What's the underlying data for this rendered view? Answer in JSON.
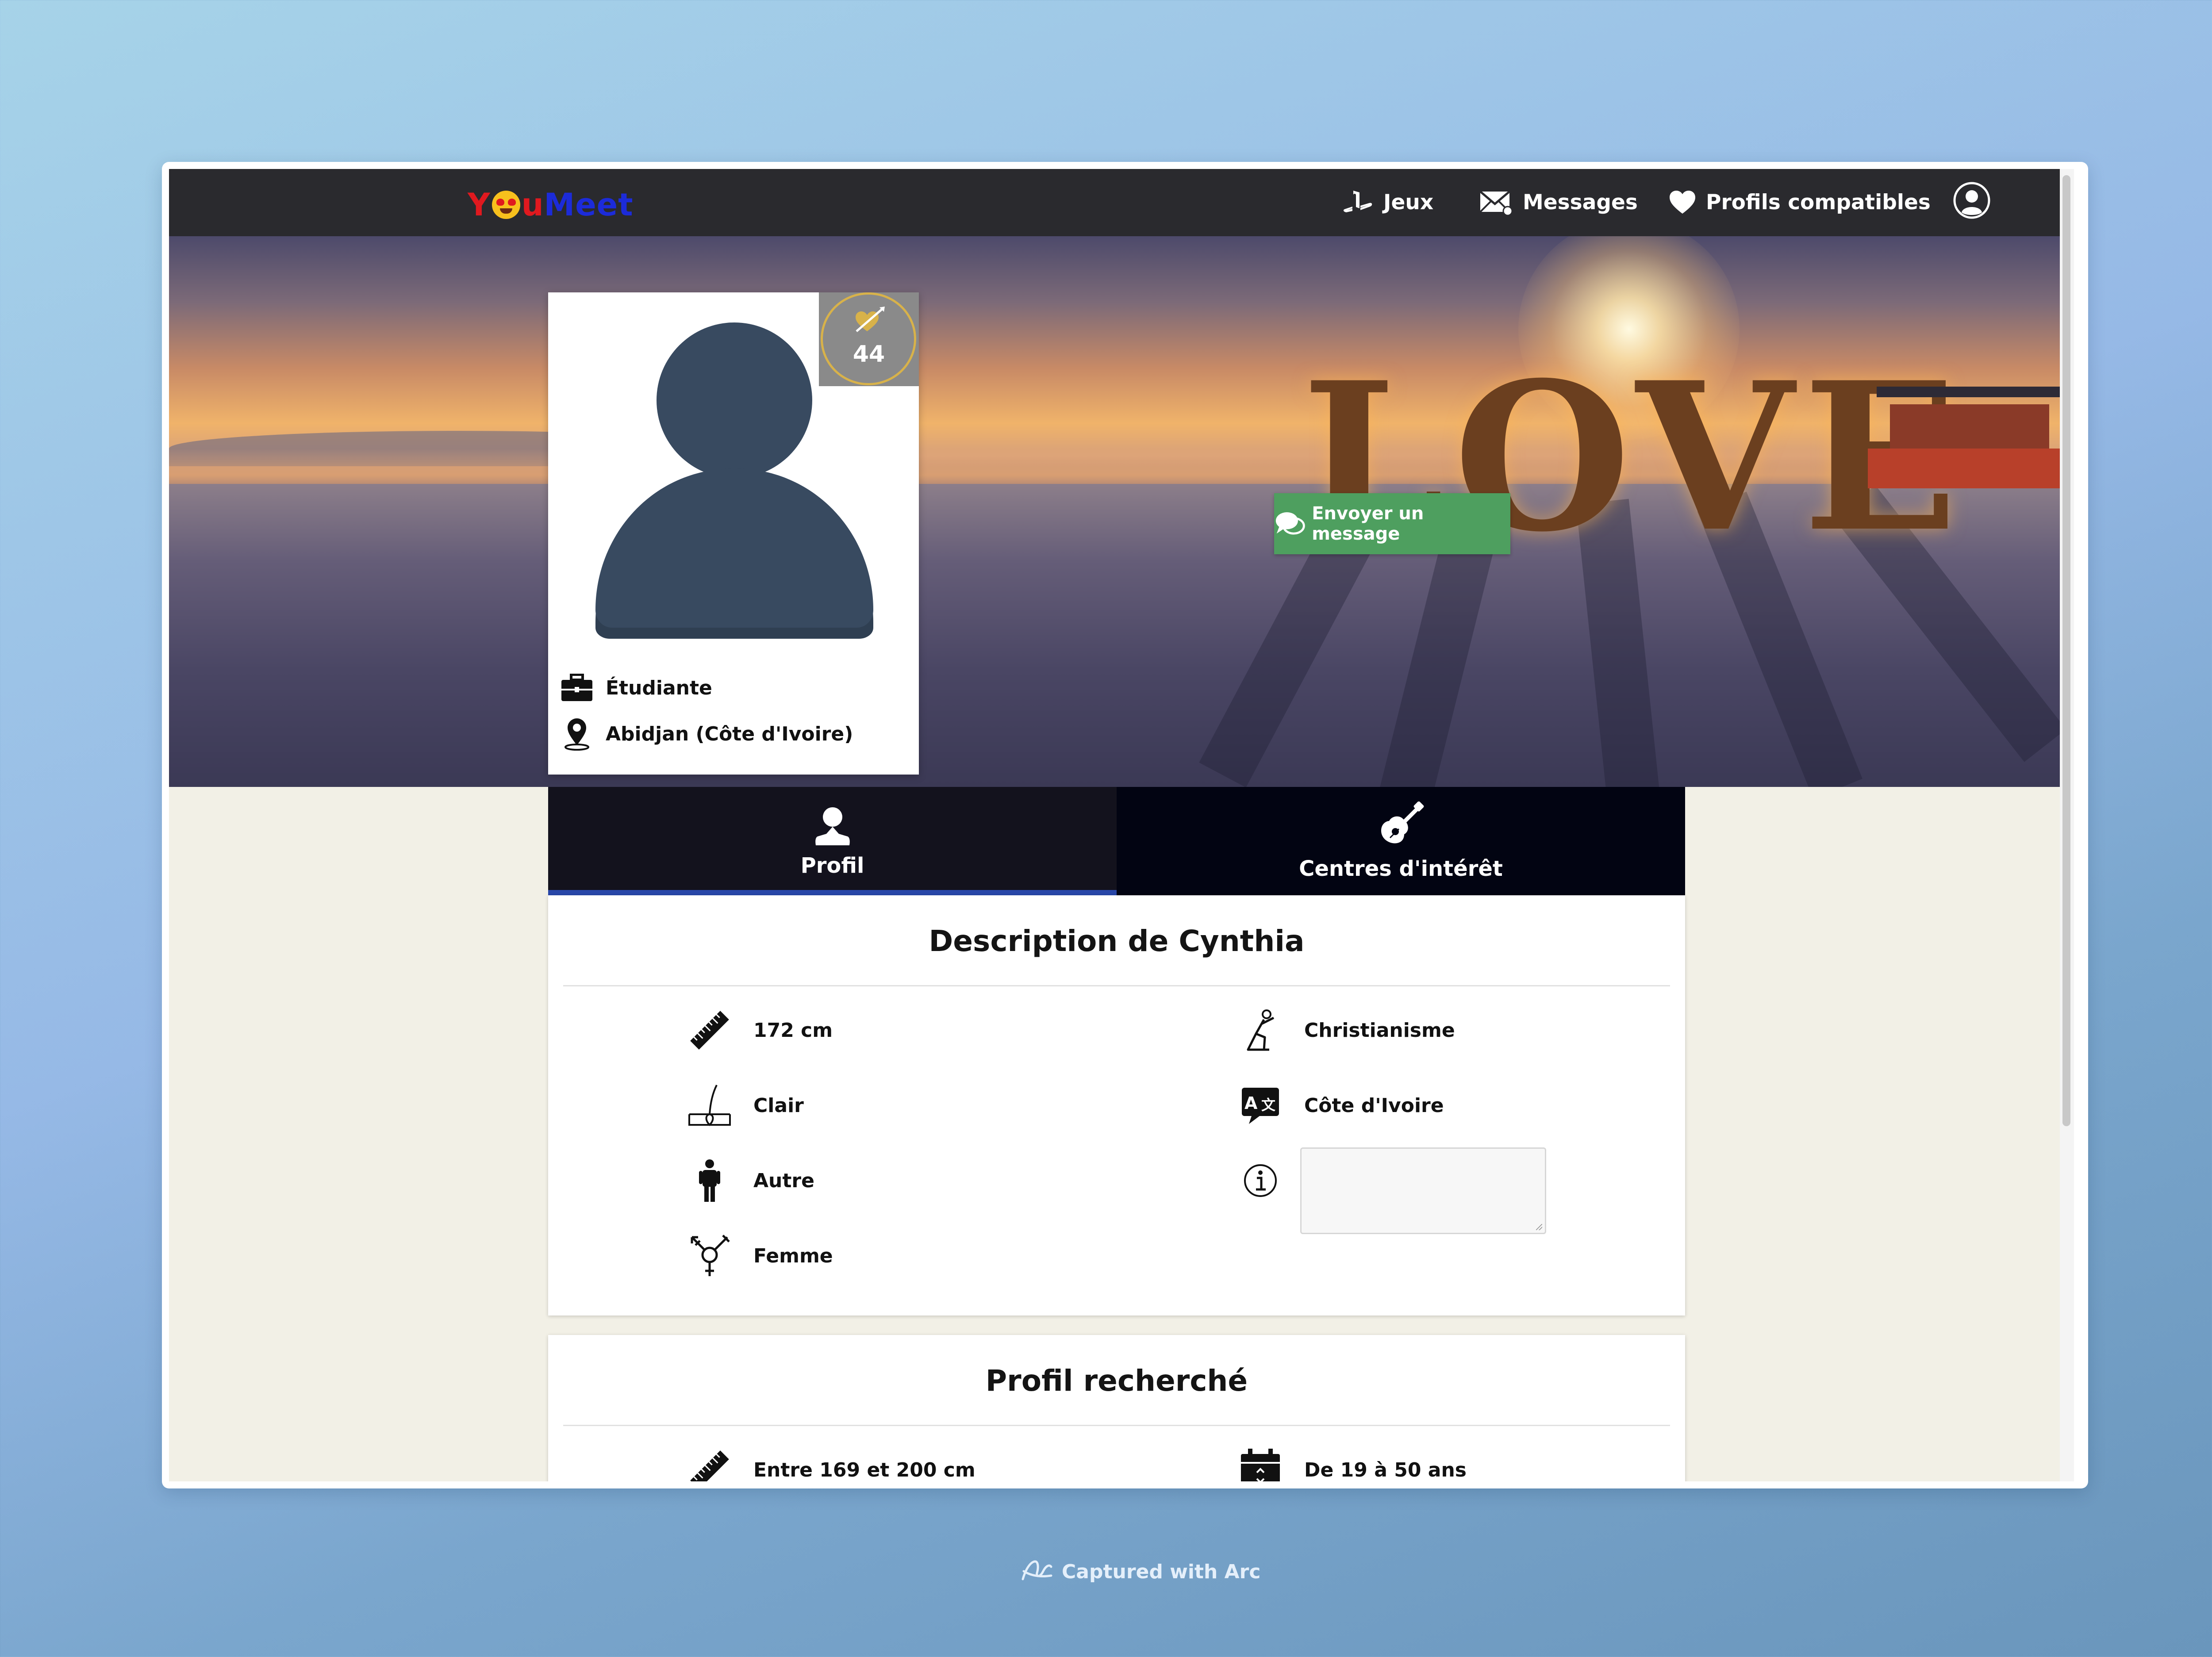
{
  "brand": {
    "logo_prefix": "Y",
    "logo_suffix_u": "u",
    "logo_suffix": "Meet"
  },
  "nav": {
    "games": "Jeux",
    "messages": "Messages",
    "matches": "Profils compatibles"
  },
  "profile": {
    "compatibility_score": "44",
    "occupation": "Étudiante",
    "location": "Abidjan (Côte d'Ivoire)",
    "send_message": "Envoyer un message"
  },
  "tabs": {
    "profile": "Profil",
    "interests": "Centres d'intérêt"
  },
  "description": {
    "title": "Description de Cynthia",
    "height": "172 cm",
    "hair": "Clair",
    "body": "Autre",
    "gender": "Femme",
    "religion": "Christianisme",
    "nationality": "Côte d'Ivoire",
    "about": ""
  },
  "seeking": {
    "title": "Profil recherché",
    "height_range": "Entre 169 et 200 cm",
    "age_range": "De 19 à 50 ans"
  },
  "footer": {
    "captured": "Captured with Arc"
  },
  "colors": {
    "navbar": "#2a2a2e",
    "cta_green": "#4e9f5f",
    "tab_active_underline": "#2846a8",
    "page_background": "#f2f0e6",
    "badge_ring": "#d8b24a"
  },
  "icons": {
    "nav": [
      "playstation-icon",
      "envelope-icon",
      "heart-icon",
      "user-circle-icon"
    ],
    "attributes": [
      "ruler-icon",
      "hair-icon",
      "person-icon",
      "gender-icon",
      "praying-icon",
      "language-icon",
      "info-icon",
      "calendar-icon"
    ]
  }
}
